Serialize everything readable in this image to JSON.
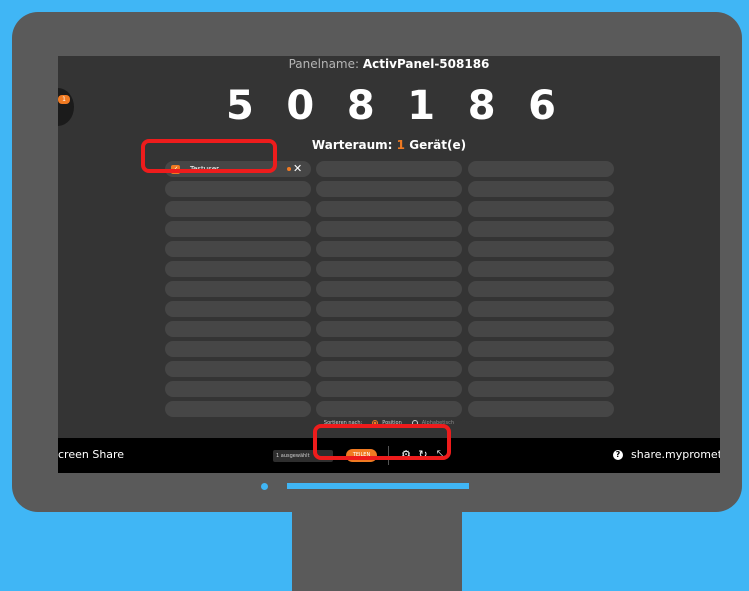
{
  "panel": {
    "label": "Panelname:",
    "name": "ActivPanel-508186",
    "code_digits": [
      "5",
      "0",
      "8",
      "1",
      "8",
      "6"
    ]
  },
  "waiting_room": {
    "label": "Warteraum:",
    "count": "1",
    "unit": "Gerät(e)"
  },
  "avatar": {
    "badge": "1"
  },
  "users": [
    {
      "name": "Testuser",
      "checked": true,
      "remove_icon": "close-icon"
    }
  ],
  "sort": {
    "label": "Sortieren nach:",
    "options": [
      {
        "label": "Position",
        "selected": true
      },
      {
        "label": "Alphabetisch",
        "selected": false
      }
    ]
  },
  "bottom_bar": {
    "app_name": "creen Share",
    "selected_count": "1 ausgewählt",
    "share_button": "TEILEN",
    "tools": [
      "gear-icon",
      "refresh-icon",
      "collapse-icon"
    ],
    "site": "share.myprometheanboard.com",
    "help_icon": "?"
  },
  "colors": {
    "accent": "#f07a22",
    "screen_bg": "#343434",
    "bar_bg": "#000000",
    "background": "#40b6f5",
    "highlight": "#ee1c1c"
  }
}
